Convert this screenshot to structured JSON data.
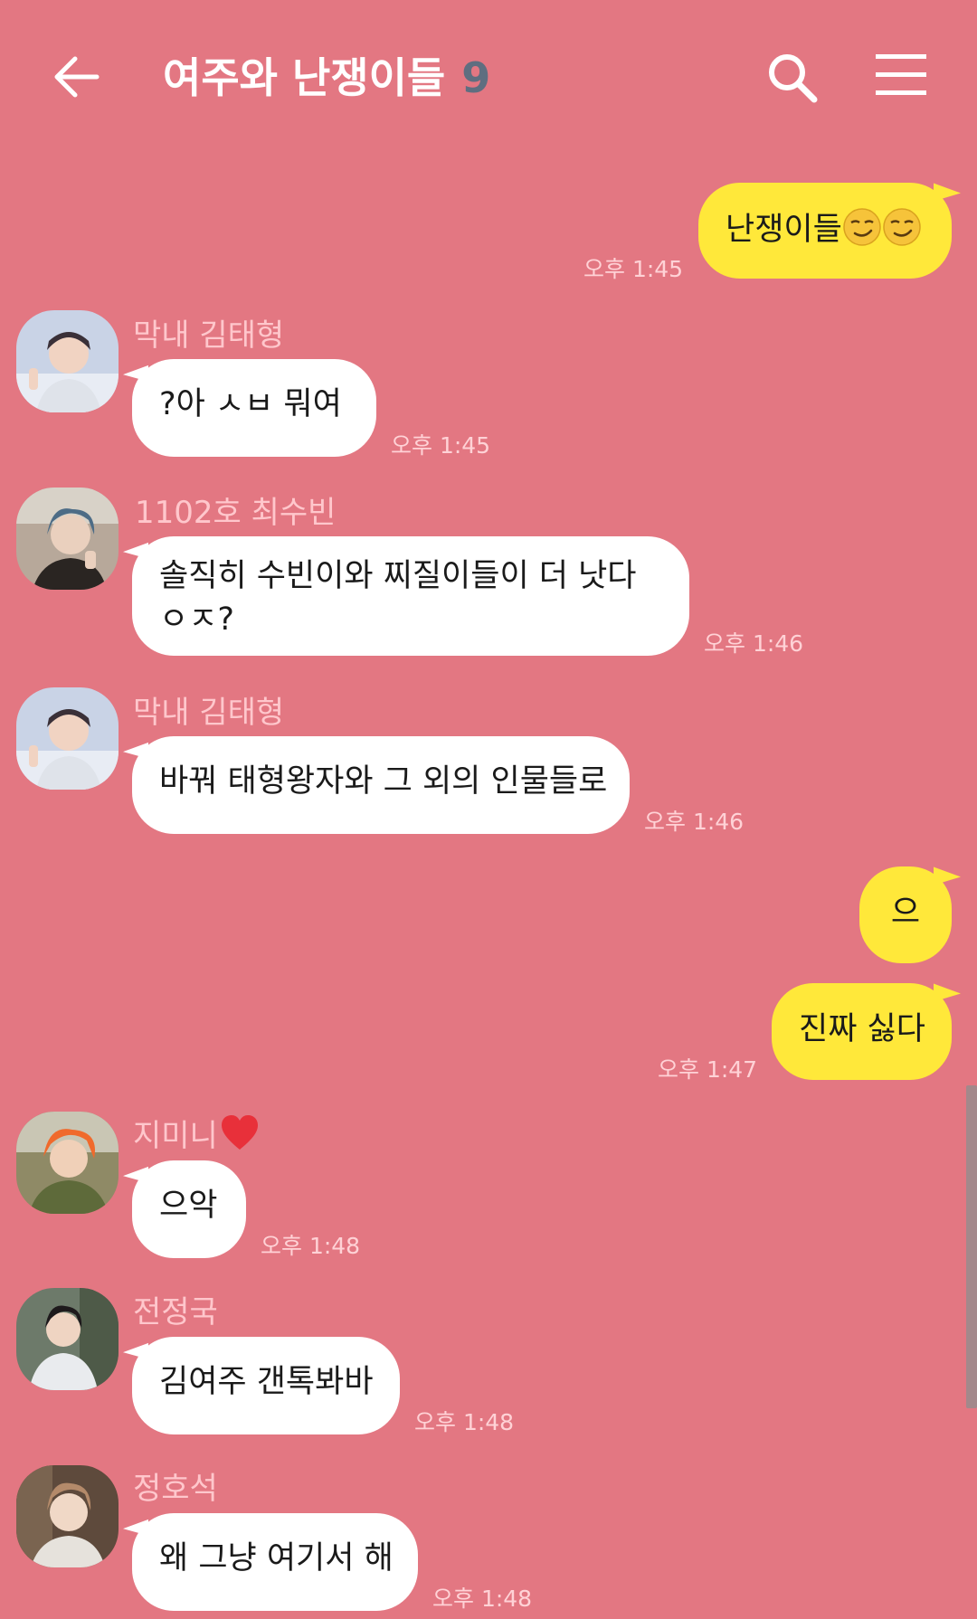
{
  "header": {
    "title": "여주와 난쟁이들",
    "member_count": "9"
  },
  "colors": {
    "background": "#e37782",
    "my_bubble": "#ffe83a",
    "other_bubble": "#ffffff",
    "sender_name": "#ffc7cc",
    "count": "#5f6e80"
  },
  "messages": [
    {
      "mine": true,
      "text": "난쟁이들",
      "emoji": "smirking-face-icon",
      "time": "오후 1:45"
    },
    {
      "mine": false,
      "sender": "막내 김태형",
      "text": "?아 ㅅㅂ 뭐여",
      "time": "오후 1:45"
    },
    {
      "mine": false,
      "sender": "1102호 최수빈",
      "line1": "솔직히 수빈이와 찌질이들이 더 낫다",
      "line2": "ㅇㅈ?",
      "time": "오후 1:46"
    },
    {
      "mine": false,
      "sender": "막내 김태형",
      "text": "바꿔 태형왕자와 그 외의 인물들로",
      "time": "오후 1:46"
    },
    {
      "mine": true,
      "text": "으"
    },
    {
      "mine": true,
      "text": "진짜 싫다",
      "time": "오후 1:47"
    },
    {
      "mine": false,
      "sender": "지미니",
      "text": "으악",
      "time": "오후 1:48"
    },
    {
      "mine": false,
      "sender": "전정국",
      "text": "김여주 갠톡봐바",
      "time": "오후 1:48"
    },
    {
      "mine": false,
      "sender": "정호석",
      "text": "왜 그냥 여기서 해",
      "time": "오후 1:48"
    }
  ]
}
